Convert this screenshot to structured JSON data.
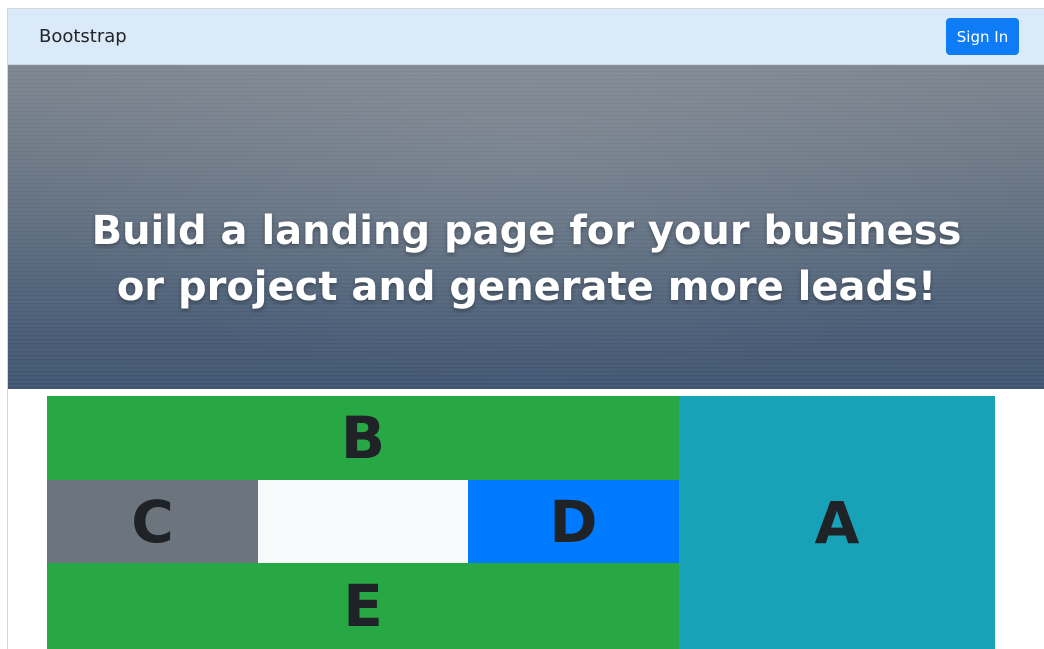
{
  "navbar": {
    "brand": "Bootstrap",
    "signin_label": "Sign In",
    "signin_color": "#0d7cf6"
  },
  "hero": {
    "heading": "Build a landing page for your business or project and generate more leads!"
  },
  "grid": {
    "b": {
      "label": "B",
      "color": "#28a745"
    },
    "c": {
      "label": "C",
      "color": "#6c757d"
    },
    "blank": {
      "label": "",
      "color": "#f8f9fa"
    },
    "d": {
      "label": "D",
      "color": "#007bff"
    },
    "e": {
      "label": "E",
      "color": "#28a745"
    },
    "a": {
      "label": "A",
      "color": "#17a2b8"
    }
  }
}
